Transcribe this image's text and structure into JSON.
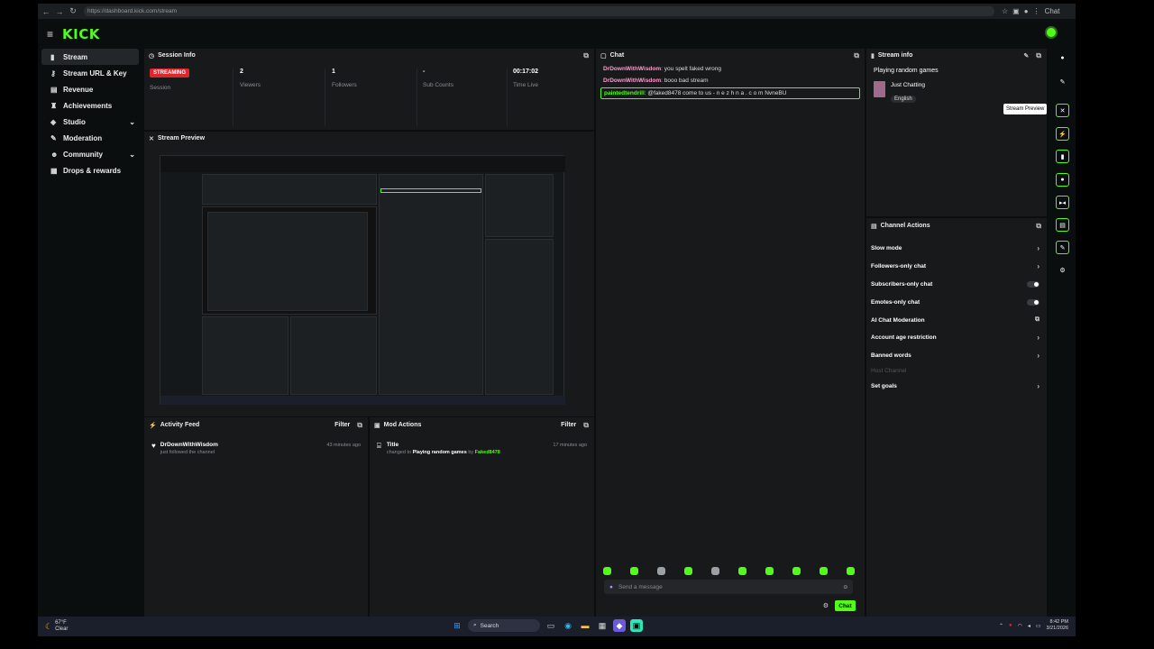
{
  "browser": {
    "url": "https://dashboard.kick.com/stream",
    "profile_label": "Chat"
  },
  "header": {
    "logo": "KICK"
  },
  "sidebar": {
    "items": [
      {
        "label": "Stream",
        "icon": "stream-icon",
        "active": true
      },
      {
        "label": "Stream URL & Key",
        "icon": "key-icon"
      },
      {
        "label": "Revenue",
        "icon": "revenue-icon"
      },
      {
        "label": "Achievements",
        "icon": "trophy-icon"
      },
      {
        "label": "Studio",
        "icon": "studio-icon",
        "expandable": true
      },
      {
        "label": "Moderation",
        "icon": "wrench-icon"
      },
      {
        "label": "Community",
        "icon": "community-icon",
        "expandable": true
      },
      {
        "label": "Drops & rewards",
        "icon": "gift-icon"
      }
    ]
  },
  "session_info": {
    "title": "Session Info",
    "status_badge": "STREAMING",
    "status_label": "Session",
    "stats": [
      {
        "value": "2",
        "label": "Viewers"
      },
      {
        "value": "1",
        "label": "Followers"
      },
      {
        "value": "-",
        "label": "Sub Counts"
      },
      {
        "value": "00:17:02",
        "label": "Time Live"
      }
    ]
  },
  "stream_preview": {
    "title": "Stream Preview"
  },
  "activity_feed": {
    "title": "Activity Feed",
    "filter_label": "Filter",
    "items": [
      {
        "user": "DrDownWithWisdom",
        "text": "just followed the channel",
        "time": "43 minutes ago"
      }
    ]
  },
  "mod_actions": {
    "title": "Mod Actions",
    "filter_label": "Filter",
    "items": [
      {
        "title": "Title",
        "prefix": "changed to",
        "value": "Playing random games",
        "by": "by",
        "user": "Faked8478",
        "time": "17 minutes ago"
      }
    ]
  },
  "chat": {
    "title": "Chat",
    "messages": [
      {
        "user": "DrDownWithWisdom",
        "text": "you spelt faked wrong",
        "user_color": "#ff9bd0"
      },
      {
        "user": "DrDownWithWisdom",
        "text": "booo bad stream",
        "user_color": "#ff9bd0"
      },
      {
        "user": "paintedtendrill",
        "text": "@faked8478 come to us - n e z h n a . c o m NvneBU",
        "user_color": "#53fc18",
        "highlighted": true
      }
    ],
    "input_placeholder": "Send a message",
    "send_label": "Chat"
  },
  "stream_info": {
    "title": "Stream info",
    "stream_title": "Playing random games",
    "category": "Just Chatting",
    "tag": "English"
  },
  "channel_actions": {
    "title": "Channel Actions",
    "items": [
      {
        "label": "Slow mode",
        "control": "chevron"
      },
      {
        "label": "Followers-only chat",
        "control": "chevron"
      },
      {
        "label": "Subscribers-only chat",
        "control": "toggle"
      },
      {
        "label": "Emotes-only chat",
        "control": "toggle"
      },
      {
        "label": "AI Chat Moderation",
        "control": "external"
      },
      {
        "label": "Account age restriction",
        "control": "chevron"
      },
      {
        "label": "Banned words",
        "control": "chevron"
      },
      {
        "label": "Host Channel",
        "control": "none",
        "disabled": true
      },
      {
        "label": "Set goals",
        "control": "chevron"
      }
    ]
  },
  "right_rail": {
    "tooltip": "Stream Preview"
  },
  "taskbar": {
    "temp": "67°F",
    "weather": "Clear",
    "search_label": "Search",
    "time": "8:42 PM",
    "date": "3/21/2026"
  },
  "colors": {
    "accent": "#53fc18",
    "streaming": "#e0262d",
    "panel": "#17191b",
    "background": "#0b0e0f"
  }
}
